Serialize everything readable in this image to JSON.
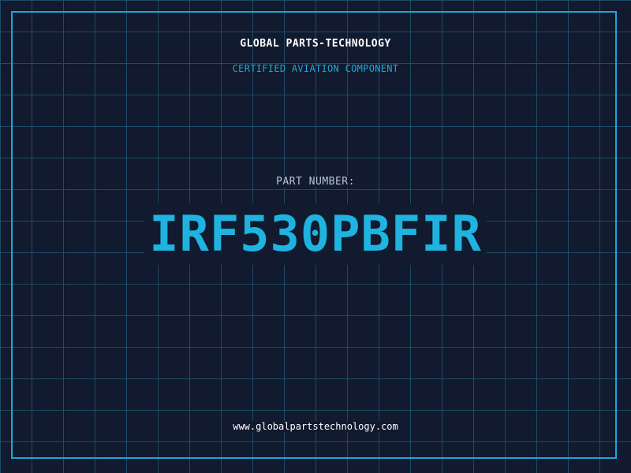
{
  "header": {
    "company": "GLOBAL PARTS-TECHNOLOGY",
    "tagline": "CERTIFIED AVIATION COMPONENT"
  },
  "part": {
    "label": "PART NUMBER:",
    "number": "IRF530PBFIR"
  },
  "footer": {
    "url": "www.globalpartstechnology.com"
  },
  "colors": {
    "background": "#111a2e",
    "grid": "#1e4b66",
    "accent": "#1fb3e0",
    "frame": "#18a8d8",
    "text": "#ffffff",
    "label": "#b8c4d8"
  }
}
